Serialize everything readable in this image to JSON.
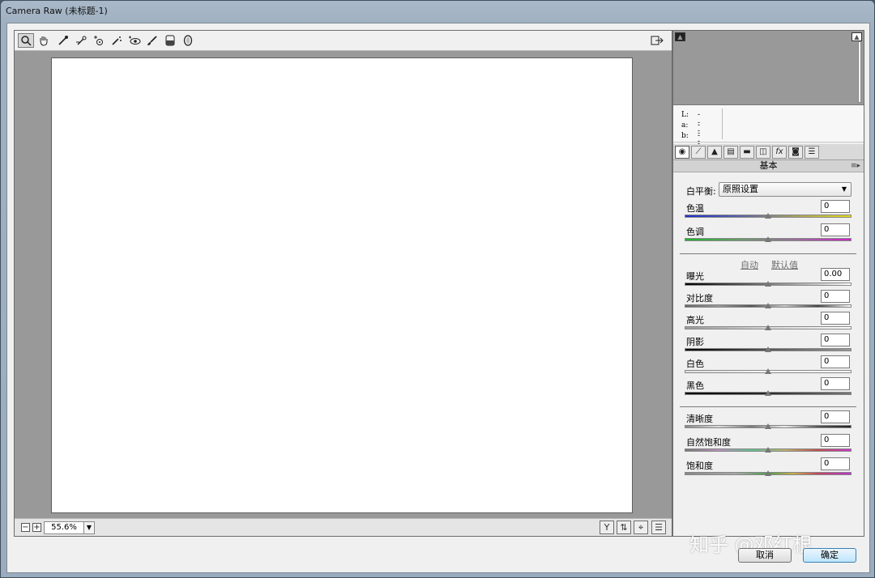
{
  "window": {
    "title": "Camera Raw (未标题-1)"
  },
  "toolbar": {
    "tools": [
      {
        "name": "zoom-tool-icon",
        "glyph": "🔍"
      },
      {
        "name": "hand-tool-icon",
        "glyph": "✋"
      },
      {
        "name": "white-balance-tool-icon",
        "glyph": "✎"
      },
      {
        "name": "color-sampler-tool-icon",
        "glyph": "✎"
      },
      {
        "name": "targeted-adjustment-tool-icon",
        "glyph": "◎"
      },
      {
        "name": "spot-removal-tool-icon",
        "glyph": "✂"
      },
      {
        "name": "red-eye-removal-tool-icon",
        "glyph": "◉"
      },
      {
        "name": "adjustment-brush-icon",
        "glyph": "🖌"
      },
      {
        "name": "graduated-filter-icon",
        "glyph": "▭"
      },
      {
        "name": "radial-filter-icon",
        "glyph": "⬭"
      }
    ],
    "open_prefs_icon": "⇥"
  },
  "preview": {
    "zoom_level": "55.6%"
  },
  "lab": {
    "rows": [
      {
        "k": "L:",
        "v": "---"
      },
      {
        "k": "a:",
        "v": "---"
      },
      {
        "k": "b:",
        "v": "---"
      }
    ]
  },
  "panel": {
    "section_title": "基本",
    "white_balance_label": "白平衡:",
    "white_balance_value": "原照设置",
    "auto_link": "自动",
    "default_link": "默认值",
    "sliders_wb": [
      {
        "label": "色温",
        "value": "0",
        "position": 0.5
      },
      {
        "label": "色调",
        "value": "0",
        "position": 0.5
      }
    ],
    "sliders_tone": [
      {
        "label": "曝光",
        "value": "0.00",
        "position": 0.5
      },
      {
        "label": "对比度",
        "value": "0",
        "position": 0.5
      },
      {
        "label": "高光",
        "value": "0",
        "position": 0.5
      },
      {
        "label": "阴影",
        "value": "0",
        "position": 0.5
      },
      {
        "label": "白色",
        "value": "0",
        "position": 0.5
      },
      {
        "label": "黑色",
        "value": "0",
        "position": 0.5
      }
    ],
    "sliders_presence": [
      {
        "label": "清晰度",
        "value": "0",
        "position": 0.5
      },
      {
        "label": "自然饱和度",
        "value": "0",
        "position": 0.5
      },
      {
        "label": "饱和度",
        "value": "0",
        "position": 0.5
      }
    ]
  },
  "buttons": {
    "cancel": "取消",
    "ok": "确定"
  },
  "watermark": "知乎 @邓红根"
}
